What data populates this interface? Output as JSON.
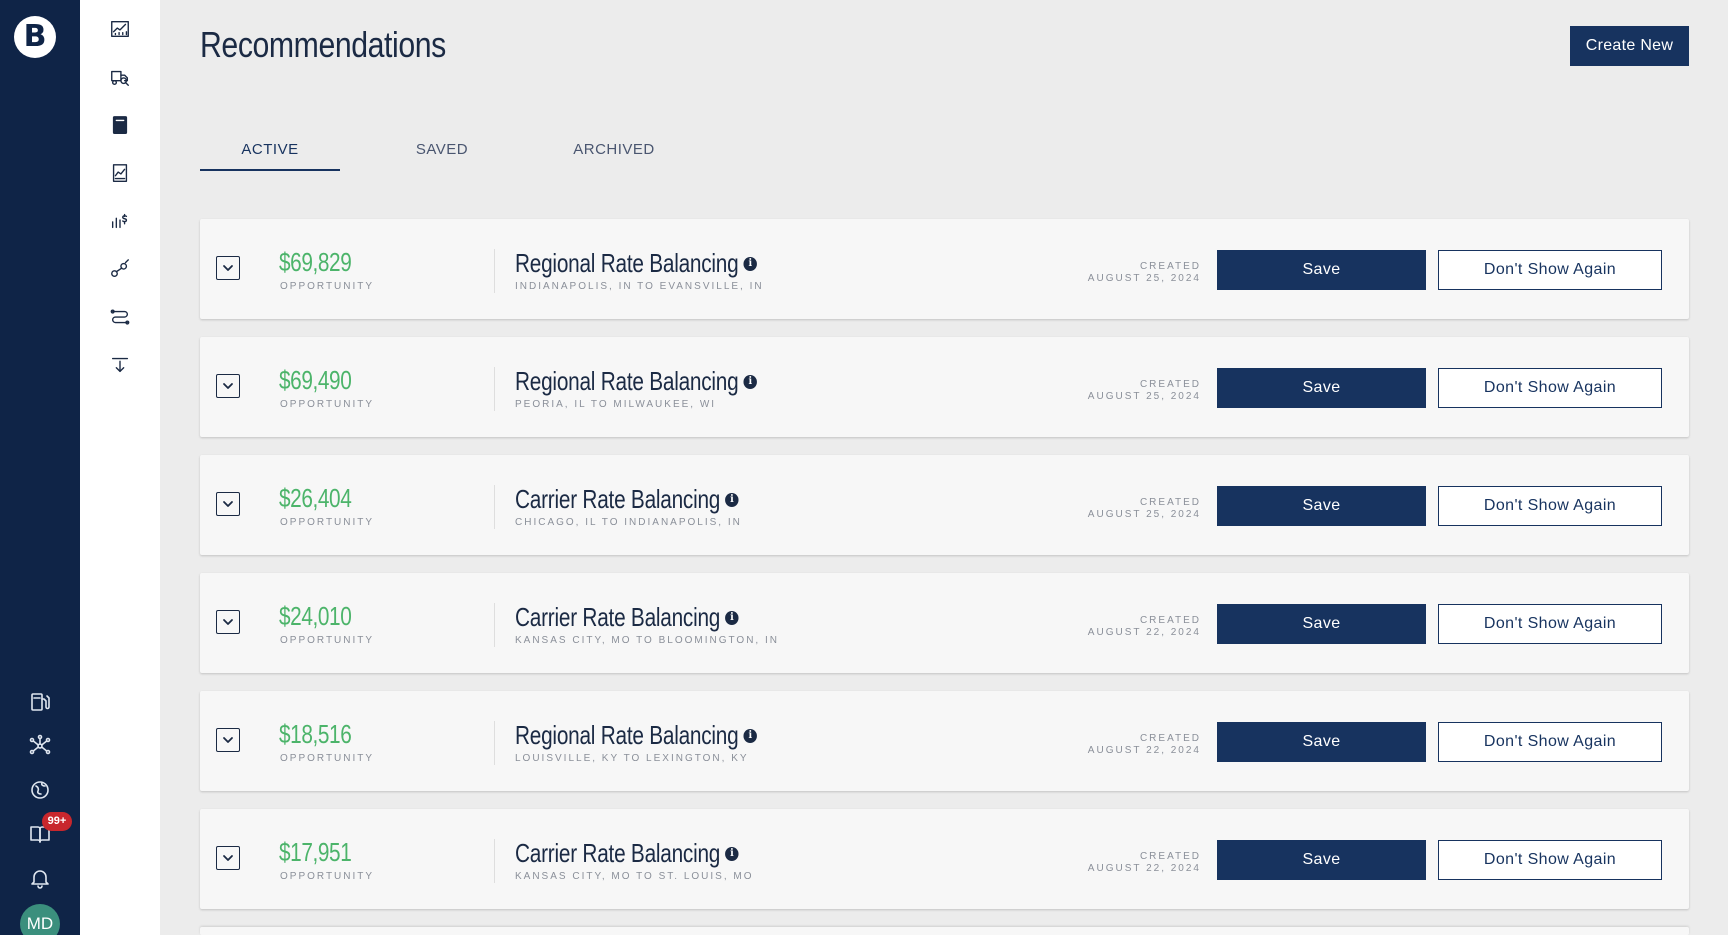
{
  "brand": {
    "logo_letter": "B"
  },
  "page": {
    "title": "Recommendations",
    "create_label": "Create New"
  },
  "tabs": [
    {
      "label": "ACTIVE",
      "active": true
    },
    {
      "label": "SAVED",
      "active": false
    },
    {
      "label": "ARCHIVED",
      "active": false
    }
  ],
  "notifications": {
    "badge": "99+"
  },
  "user": {
    "initials": "MD"
  },
  "labels": {
    "opportunity": "OPPORTUNITY",
    "created": "CREATED",
    "save": "Save",
    "dont_show": "Don't Show Again"
  },
  "recommendations": [
    {
      "amount": "$69,829",
      "title": "Regional Rate Balancing",
      "route": "INDIANAPOLIS, IN TO EVANSVILLE, IN",
      "date": "AUGUST 25, 2024"
    },
    {
      "amount": "$69,490",
      "title": "Regional Rate Balancing",
      "route": "PEORIA, IL TO MILWAUKEE, WI",
      "date": "AUGUST 25, 2024"
    },
    {
      "amount": "$26,404",
      "title": "Carrier Rate Balancing",
      "route": "CHICAGO, IL TO INDIANAPOLIS, IN",
      "date": "AUGUST 25, 2024"
    },
    {
      "amount": "$24,010",
      "title": "Carrier Rate Balancing",
      "route": "KANSAS CITY, MO TO BLOOMINGTON, IN",
      "date": "AUGUST 22, 2024"
    },
    {
      "amount": "$18,516",
      "title": "Regional Rate Balancing",
      "route": "LOUISVILLE, KY TO LEXINGTON, KY",
      "date": "AUGUST 22, 2024"
    },
    {
      "amount": "$17,951",
      "title": "Carrier Rate Balancing",
      "route": "KANSAS CITY, MO TO ST. LOUIS, MO",
      "date": "AUGUST 22, 2024"
    }
  ],
  "colors": {
    "navy": "#0f2447",
    "button": "#17335f",
    "amount_green": "#4cb46a"
  }
}
